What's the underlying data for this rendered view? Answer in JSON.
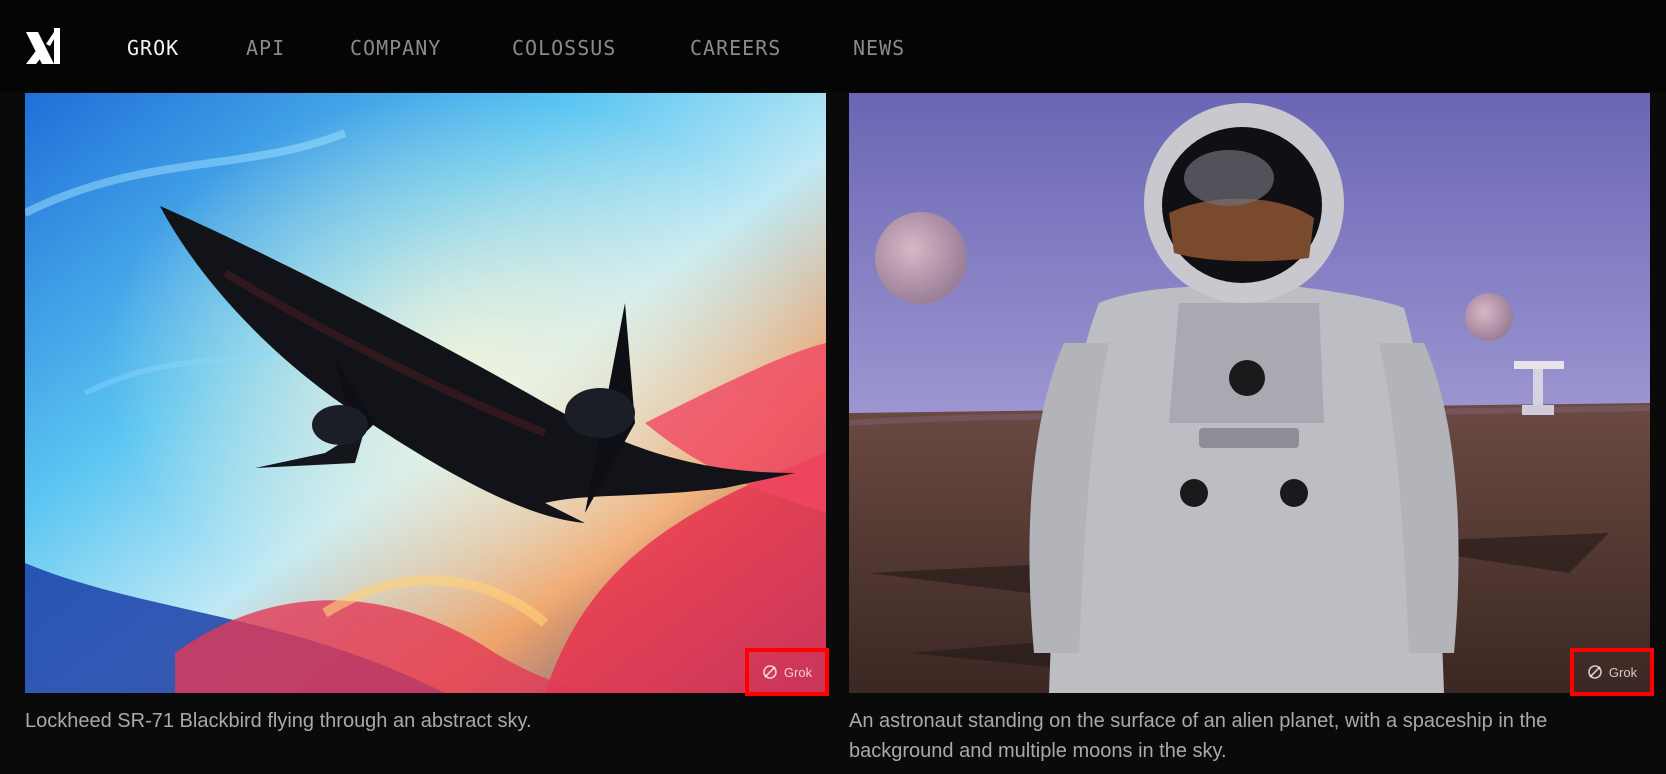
{
  "nav": {
    "items": [
      {
        "label": "GROK",
        "active": true
      },
      {
        "label": "API",
        "active": false
      },
      {
        "label": "COMPANY",
        "active": false
      },
      {
        "label": "COLOSSUS",
        "active": false
      },
      {
        "label": "CAREERS",
        "active": false
      },
      {
        "label": "NEWS",
        "active": false
      }
    ]
  },
  "cards": [
    {
      "caption": "Lockheed SR-71 Blackbird flying through an abstract sky.",
      "badge": "Grok"
    },
    {
      "caption_line1": "An astronaut standing on the surface of an alien planet, with a spaceship in the",
      "caption_line2": "background and multiple moons in the sky.",
      "badge": "Grok"
    }
  ]
}
